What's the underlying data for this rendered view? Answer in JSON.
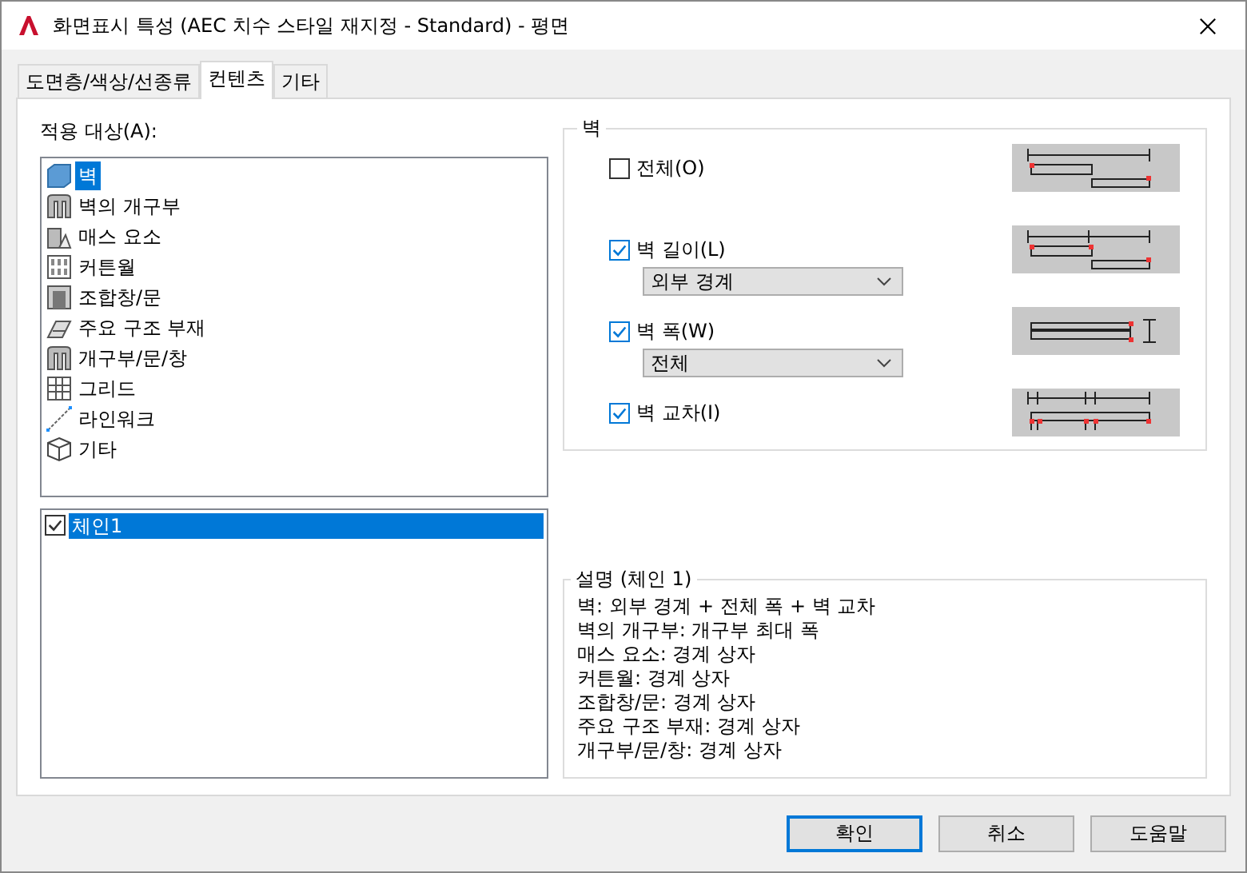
{
  "window": {
    "title": "화면표시 특성 (AEC 치수 스타일 재지정 - Standard) - 평면"
  },
  "tabs": [
    {
      "label": "도면층/색상/선종류",
      "selected": false
    },
    {
      "label": "컨텐츠",
      "selected": true
    },
    {
      "label": "기타",
      "selected": false
    }
  ],
  "applies_to": {
    "label": "적용 대상(A):",
    "items": [
      {
        "label": "벽",
        "kind": "wall",
        "selected": true
      },
      {
        "label": "벽의 개구부",
        "kind": "opening",
        "selected": false
      },
      {
        "label": "매스 요소",
        "kind": "mass",
        "selected": false
      },
      {
        "label": "커튼월",
        "kind": "curtain",
        "selected": false
      },
      {
        "label": "조합창/문",
        "kind": "assembly",
        "selected": false
      },
      {
        "label": "주요 구조 부재",
        "kind": "beam",
        "selected": false
      },
      {
        "label": "개구부/문/창",
        "kind": "opening",
        "selected": false
      },
      {
        "label": "그리드",
        "kind": "grid",
        "selected": false
      },
      {
        "label": "라인워크",
        "kind": "line",
        "selected": false
      },
      {
        "label": "기타",
        "kind": "cube",
        "selected": false
      }
    ]
  },
  "chains": [
    {
      "label": "체인1",
      "checked": true,
      "selected": true
    }
  ],
  "wall_group": {
    "title": "벽",
    "options": [
      {
        "label": "전체(O)",
        "checked": false
      },
      {
        "label": "벽 길이(L)",
        "checked": true,
        "dropdown": "외부 경계"
      },
      {
        "label": "벽 폭(W)",
        "checked": true,
        "dropdown": "전체"
      },
      {
        "label": "벽 교차(I)",
        "checked": true
      }
    ]
  },
  "description": {
    "title": "설명 (체인 1)",
    "lines": [
      "벽: 외부 경계 + 전체 폭 + 벽 교차",
      "벽의 개구부: 개구부 최대 폭",
      "매스 요소: 경계 상자",
      "커튼월: 경계 상자",
      "조합창/문: 경계 상자",
      "주요 구조 부재: 경계 상자",
      "개구부/문/창: 경계 상자"
    ]
  },
  "buttons": [
    {
      "label": "확인",
      "default": true
    },
    {
      "label": "취소",
      "default": false
    },
    {
      "label": "도움말",
      "default": false
    }
  ]
}
